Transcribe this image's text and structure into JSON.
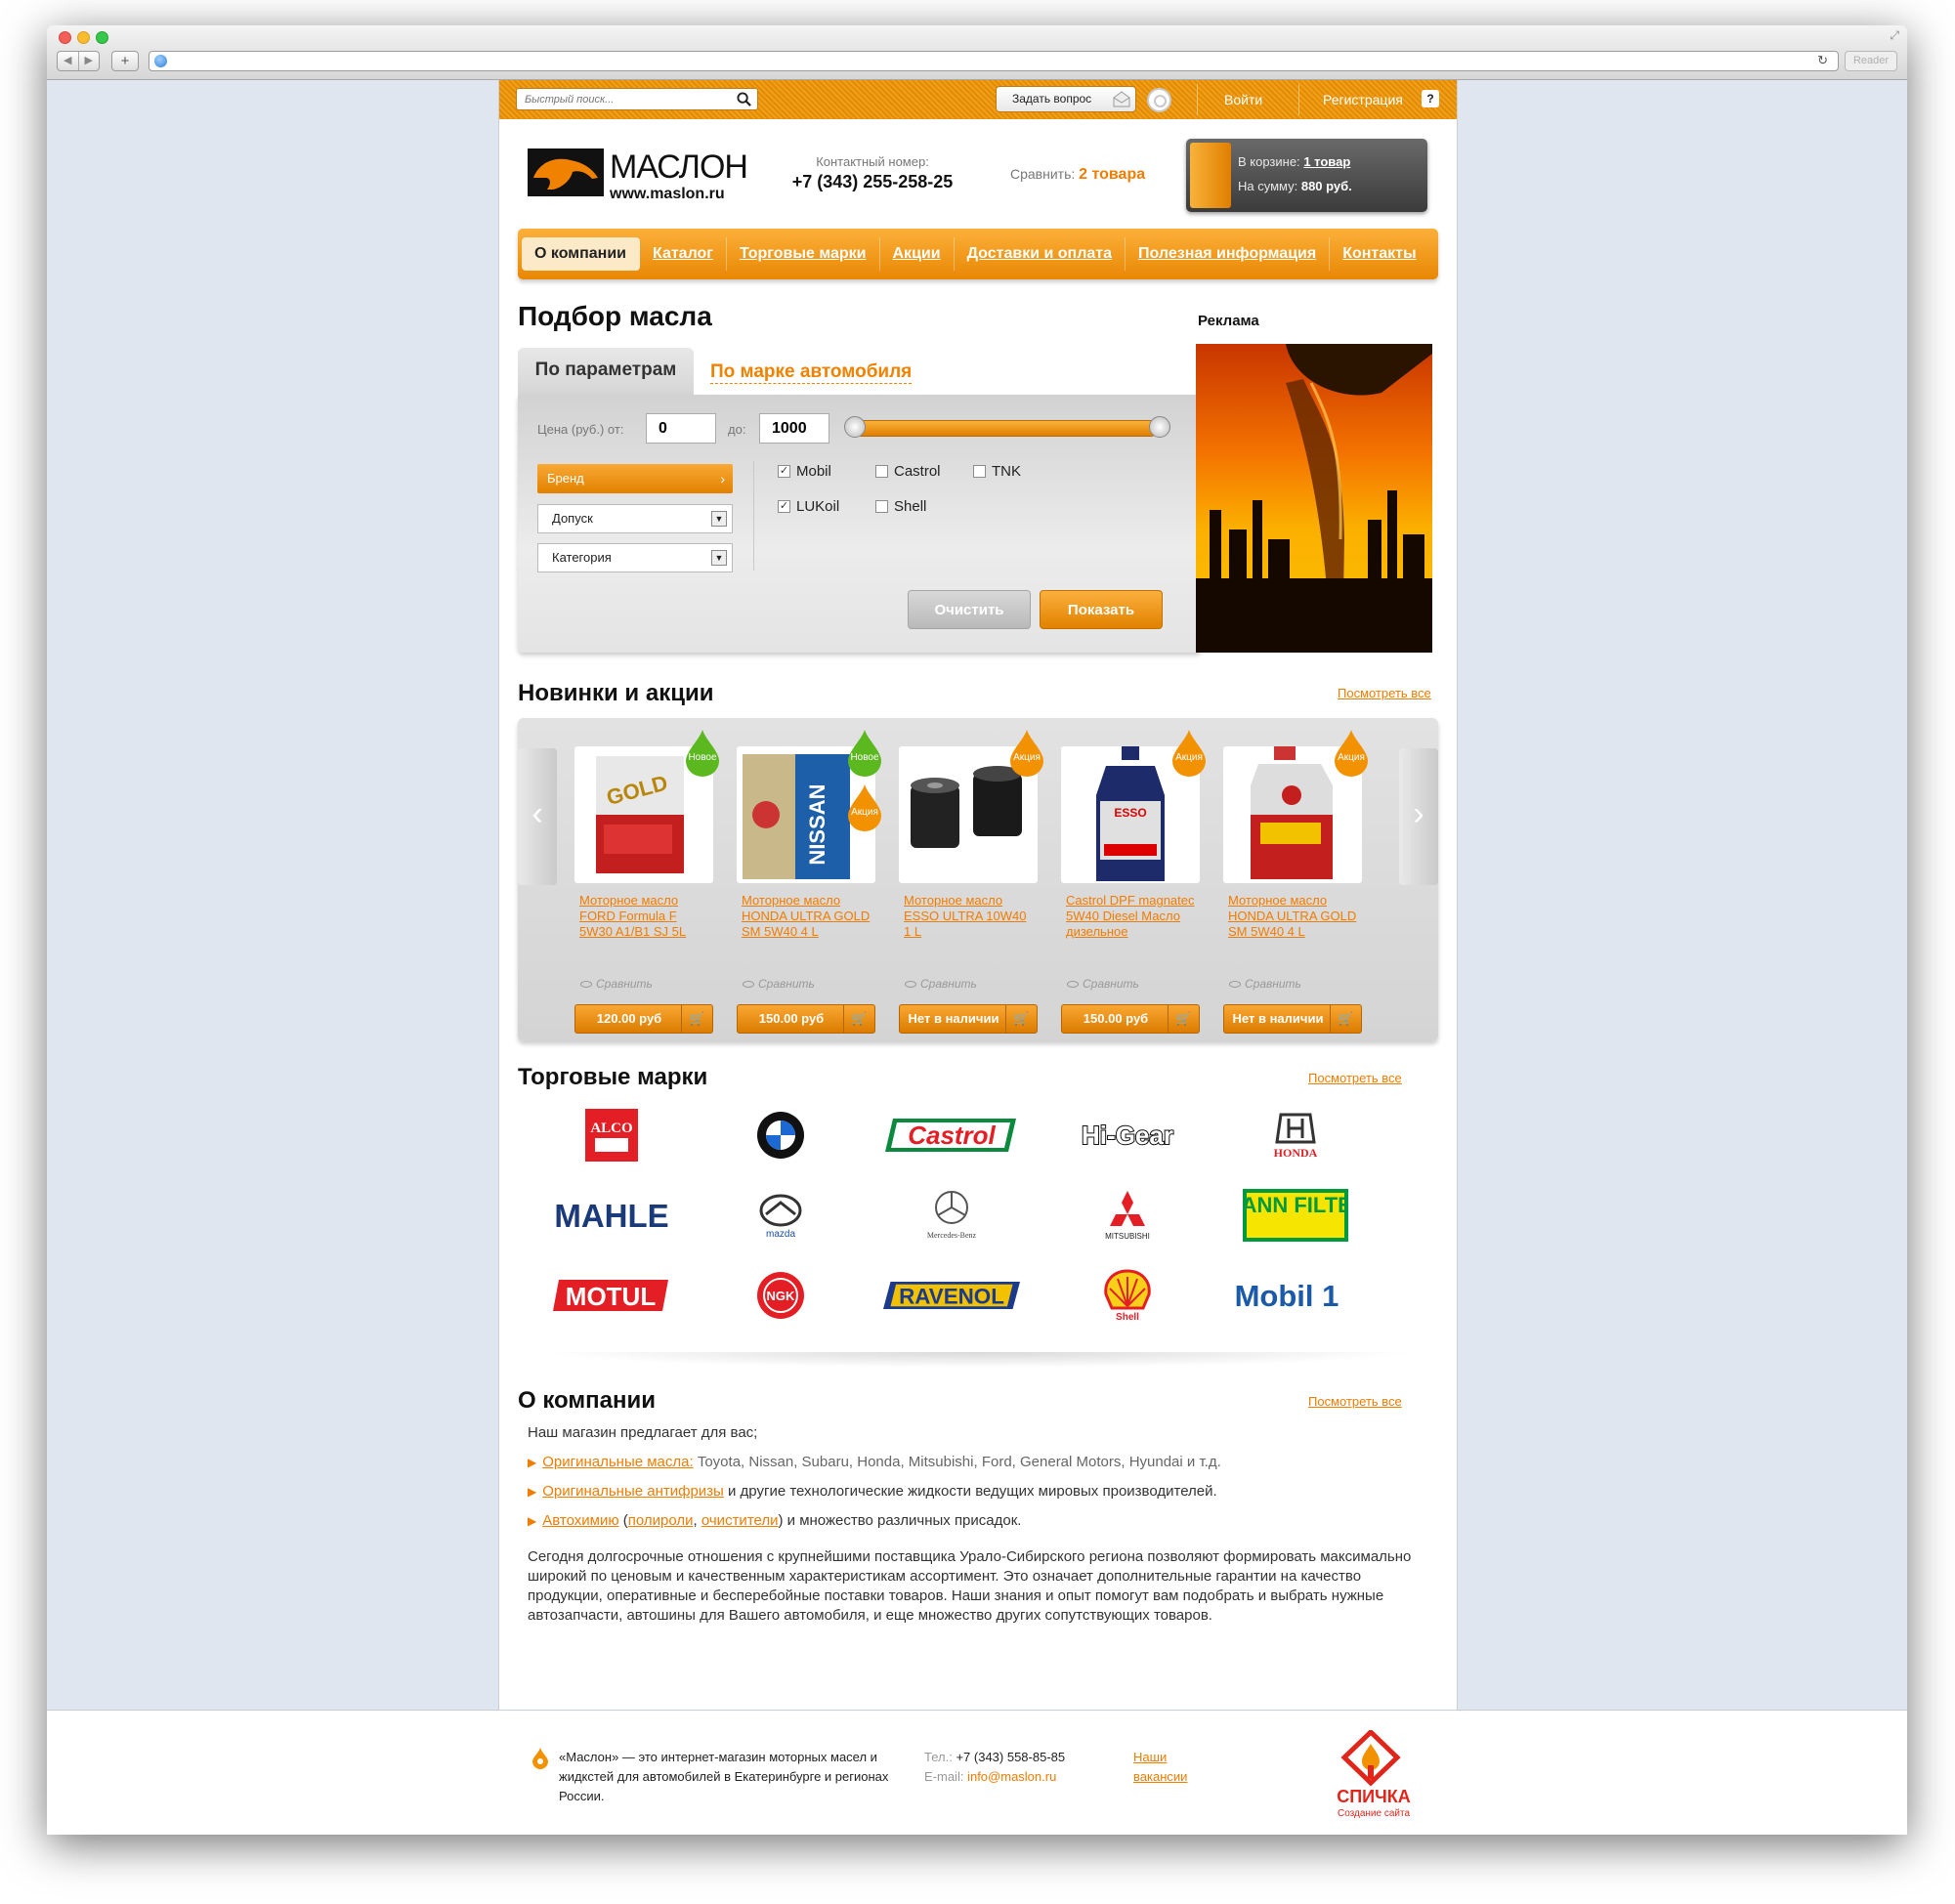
{
  "browser": {
    "reader_label": "Reader"
  },
  "topbar": {
    "search_placeholder": "Быстрый поиск...",
    "ask_label": "Задать вопрос",
    "login_label": "Войти",
    "register_label": "Регистрация",
    "help_label": "?"
  },
  "header": {
    "logo_name": "МАСЛОН",
    "logo_url": "www.maslon.ru",
    "contact_label": "Контактный номер:",
    "contact_phone": "+7 (343) 255-258-25",
    "compare_label": "Сравнить:",
    "compare_link": "2 товара",
    "cart_label": "В корзине:",
    "cart_count": "1 товар",
    "cart_sum_label": "На сумму:",
    "cart_sum": "880 руб."
  },
  "nav": {
    "items": [
      "О компании",
      "Каталог",
      "Торговые марки",
      "Акции",
      "Доставки и оплата",
      "Полезная информация",
      "Контакты"
    ]
  },
  "filter": {
    "title": "Подбор масла",
    "tab_params": "По параметрам",
    "tab_car": "По марке автомобиля",
    "price_label": "Цена (руб.) от:",
    "price_from": "0",
    "price_to_label": "до:",
    "price_to": "1000",
    "brand_label": "Бренд",
    "dopusk_label": "Допуск",
    "category_label": "Категория",
    "brands": [
      {
        "name": "Mobil",
        "checked": "✓"
      },
      {
        "name": "Castrol",
        "checked": ""
      },
      {
        "name": "TNK",
        "checked": ""
      },
      {
        "name": "LUKoil",
        "checked": "✓"
      },
      {
        "name": "Shell",
        "checked": ""
      }
    ],
    "clear_label": "Очистить",
    "show_label": "Показать"
  },
  "ad": {
    "label": "Реклама"
  },
  "news": {
    "title": "Новинки и акции",
    "view_all": "Посмотреть все",
    "compare_label": "Сравнить",
    "products": [
      {
        "name": "Моторное масло FORD Formula F 5W30 A1/B1 SJ 5L",
        "price": "120.00 руб",
        "badges": [
          "Новое"
        ]
      },
      {
        "name": "Моторное масло HONDA ULTRA GOLD SM 5W40 4 L",
        "price": "150.00 руб",
        "badges": [
          "Новое",
          "Акция"
        ]
      },
      {
        "name": "Моторное масло ESSO ULTRA 10W40 1 L",
        "price": "Нет в наличии",
        "badges": [
          "Акция"
        ]
      },
      {
        "name": "Castrol DPF magnatec 5W40 Diesel Масло дизельное",
        "price": "150.00 руб",
        "badges": [
          "Акция"
        ]
      },
      {
        "name": "Моторное масло HONDA ULTRA GOLD SM 5W40 4 L",
        "price": "Нет в наличии",
        "badges": [
          "Акция"
        ]
      }
    ]
  },
  "brands": {
    "title": "Торговые марки",
    "view_all": "Посмотреть все",
    "logos": [
      "ALCO",
      "BMW",
      "Castrol",
      "Hi-Gear",
      "HONDA",
      "MAHLE",
      "mazda",
      "Mercedes-Benz",
      "MITSUBISHI",
      "MANN FILTER",
      "MOTUL",
      "NGK",
      "RAVENOL",
      "Shell",
      "Mobil 1"
    ]
  },
  "about": {
    "title": "О компании",
    "view_all": "Посмотреть все",
    "intro": "Наш магазин предлагает для вас;",
    "li1_link": "Оригинальные масла:",
    "li1_text": " Toyota, Nissan, Subaru, Honda, Mitsubishi, Ford, General Motors, Hyundai и т.д.",
    "li2_link": "Оригинальные антифризы",
    "li2_text": " и другие технологические жидкости ведущих мировых производителей.",
    "li3_link": "Автохимию",
    "li3_open": " (",
    "li3_link2": "полироли",
    "li3_comma": ", ",
    "li3_link3": "очистители",
    "li3_text": ") и множество различных присадок.",
    "paragraph": "Сегодня долгосрочные отношения с крупнейшими поставщика Урало-Сибирского региона позволяют формировать максимально широкий по ценовым и качественным характеристикам ассортимент. Это означает дополнительные гарантии на качество продукции, оперативные и бесперебойные поставки товаров. Наши знания и опыт помогут вам подобрать и выбрать нужные автозапчасти, автошины для Вашего автомобиля, и еще множество других сопутствующих товаров."
  },
  "footer": {
    "description": "«Маслон» — это интернет-магазин моторных масел и жидкстей для автомобилей в Екатеринбурге и регионах России.",
    "tel_label": "Тел.:",
    "tel": "+7 (343) 558-85-85",
    "email_label": "E-mail:",
    "email": "info@maslon.ru",
    "vacancies": "Наши вакансии",
    "studio_name": "СПИЧКА",
    "studio_sub": "Создание сайта"
  },
  "colors": {
    "accent": "#f08200",
    "nav_orange": "#e98703",
    "new_badge": "#5bb81f",
    "sale_badge": "#f39200"
  }
}
